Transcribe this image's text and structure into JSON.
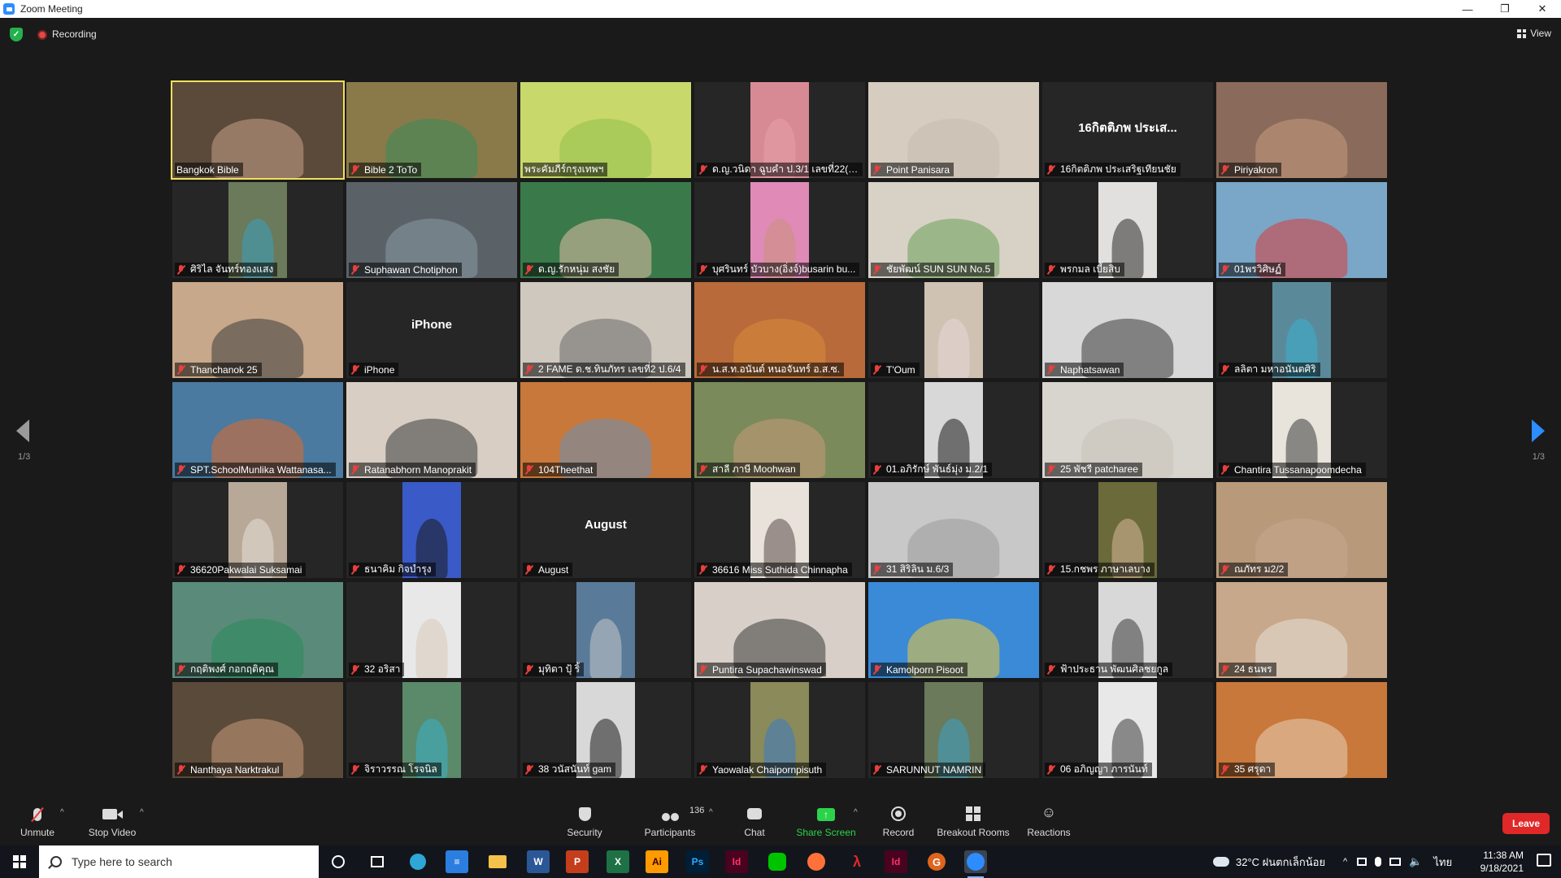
{
  "window": {
    "title": "Zoom Meeting"
  },
  "status": {
    "recording_label": "Recording",
    "view_label": "View"
  },
  "pagination": {
    "left_page": "1/3",
    "right_page": "1/3"
  },
  "tiles": [
    {
      "name": "Bangkok Bible",
      "active": true,
      "muted": false,
      "bg": "#5b4a3a",
      "person": "#c9a38a"
    },
    {
      "name": "Bible 2 ToTo",
      "muted": true,
      "bg": "#8a7a4a",
      "person": "#3a8a5a"
    },
    {
      "name": "พระคัมภีร์กรุงเทพฯ",
      "muted": false,
      "bg": "#c9d86a",
      "person": "#8fc14a"
    },
    {
      "name": "ด.ญ.วนิดา ฉูบคำ ป.3/1 เลขที่22(w...",
      "muted": true,
      "bg": "#d88a94",
      "person": "#e8a0a8",
      "narrow": true
    },
    {
      "name": "Point Panisara",
      "muted": true,
      "bg": "#d6ccc0",
      "person": "#c8bcae"
    },
    {
      "name": "16กิตติภพ ประเสริฐเทียนชัย",
      "muted": true,
      "big": "16กิตติภพ ประเส..."
    },
    {
      "name": "Piriyakron",
      "muted": true,
      "bg": "#8a6a5a",
      "person": "#c89a80"
    },
    {
      "name": "ศิริไล จันทร์ทองแสง",
      "muted": true,
      "bg": "#6a7a5a",
      "person": "#3aa0c0",
      "narrow": true
    },
    {
      "name": "Suphawan Chotiphon",
      "muted": true,
      "bg": "#5a6268",
      "person": "#8a9aa2"
    },
    {
      "name": "ด.ญ.รักหนุ่ม สงชัย",
      "muted": true,
      "bg": "#3a7a4a",
      "person": "#e2c0a8"
    },
    {
      "name": "บุศรินทร์ บัวบาง(อิ่งจ์)busarin bu...",
      "muted": true,
      "bg": "#e08ab8",
      "person": "#c9927a",
      "narrow": true
    },
    {
      "name": "ชัยพัฒน์ SUN SUN No.5",
      "muted": true,
      "bg": "#d8d2c6",
      "person": "#6aa05a"
    },
    {
      "name": "พรกมล เบี้ยสิบ",
      "muted": true,
      "bg": "#e2e0de",
      "person": "#2a2a2a",
      "narrow": true
    },
    {
      "name": "01พรวิศิษฏ์",
      "muted": true,
      "bg": "#7aa6c8",
      "person": "#d83a3a"
    },
    {
      "name": "Thanchanok 25",
      "muted": true,
      "bg": "#c8a88a",
      "person": "#3a3a3a"
    },
    {
      "name": "iPhone",
      "muted": true,
      "big": "iPhone"
    },
    {
      "name": "2 FAME ด.ช.ทินภัทร เลขที่2 ป.6/4",
      "muted": true,
      "bg": "#cfc8be",
      "person": "#6a6a6a"
    },
    {
      "name": "น.ส.ท.อนันต์ หนอจันทร์ อ.ส.ซ.",
      "muted": true,
      "bg": "#b86a3a",
      "person": "#d88a3a"
    },
    {
      "name": "T'Oum",
      "muted": true,
      "bg": "#cfc2b2",
      "person": "#e8d8d8",
      "narrow": true
    },
    {
      "name": "Naphatsawan",
      "muted": true,
      "bg": "#d8d8d8",
      "person": "#3a3a3a"
    },
    {
      "name": "ลลิตา มหาอนันตศิริ",
      "muted": true,
      "bg": "#5a8a9a",
      "person": "#3ab0d0",
      "narrow": true
    },
    {
      "name": "SPT.SchoolMunlika Wattanasa...",
      "muted": true,
      "bg": "#4a7aa0",
      "person": "#e06a2a"
    },
    {
      "name": "Ratanabhorn Manoprakit",
      "muted": true,
      "bg": "#d8cec4",
      "person": "#3a3a3a"
    },
    {
      "name": "104Theethat",
      "muted": true,
      "bg": "#c8783a",
      "person": "#6a90b8"
    },
    {
      "name": "สาลี ภาษี Moohwan",
      "muted": true,
      "bg": "#7a8a5a",
      "person": "#c89a7a"
    },
    {
      "name": "01.อภิรักษ์ พันธ์มุ่ง ม.2/1",
      "muted": true,
      "bg": "#d8d8d8",
      "person": "#1a1a1a",
      "narrow": true
    },
    {
      "name": "25 พัชรี patcharee",
      "muted": true,
      "bg": "#d8d4ce",
      "person": "#c8c2ba"
    },
    {
      "name": "Chantira Tussanapoomdecha",
      "muted": true,
      "bg": "#e8e4dc",
      "person": "#3a3a3a",
      "narrow": true
    },
    {
      "name": "36620Pakwalai Suksamai",
      "muted": true,
      "bg": "#b8a898",
      "person": "#e8e0d8",
      "narrow": true
    },
    {
      "name": "ธนาคิม กิจบำรุง",
      "muted": true,
      "bg": "#3a5ac8",
      "person": "#1a1a1a",
      "narrow": true
    },
    {
      "name": "August",
      "muted": true,
      "big": "August"
    },
    {
      "name": "36616 Miss Suthida Chinnapha",
      "muted": true,
      "bg": "#e8e2da",
      "person": "#5a4a4a",
      "narrow": true
    },
    {
      "name": "31 สิริลิน ม.6/3",
      "muted": true,
      "bg": "#c8c8c8",
      "person": "#9a9a9a"
    },
    {
      "name": "15.กชพร ภาษาเลบาง",
      "muted": true,
      "bg": "#6a6a3a",
      "person": "#d8b89a",
      "narrow": true
    },
    {
      "name": "ณภัทร ม2/2",
      "muted": true,
      "bg": "#b89a7a",
      "person": "#c8a890"
    },
    {
      "name": "กฤติพงศ์ กอกฤติคุณ",
      "muted": true,
      "bg": "#5a8a7a",
      "person": "#2a8a5a"
    },
    {
      "name": "32 อริสา",
      "muted": true,
      "bg": "#e8e8e8",
      "person": "#d8c8b8",
      "narrow": true
    },
    {
      "name": "มุทิตา ปุ้ ริ้",
      "muted": true,
      "bg": "#5a7a9a",
      "person": "#c8c8c8",
      "narrow": true
    },
    {
      "name": "Puntira Supachawinswad",
      "muted": true,
      "bg": "#d8d0c8",
      "person": "#3a3a3a"
    },
    {
      "name": "Kamolporn Pisoot",
      "muted": true,
      "bg": "#3a8ad8",
      "person": "#f0c83a"
    },
    {
      "name": "ฟ้าประธาน พัฒนศิลชยกูล",
      "muted": true,
      "bg": "#d8d8d8",
      "person": "#3a3a3a",
      "narrow": true
    },
    {
      "name": "24 ธนพร",
      "muted": true,
      "bg": "#c8a88a",
      "person": "#e8e0d8"
    },
    {
      "name": "Nanthaya Narktrakul",
      "muted": true,
      "bg": "#5a4a3a",
      "person": "#c89a7a"
    },
    {
      "name": "จิราวรรณ โรจนิล",
      "muted": true,
      "bg": "#5a8a6a",
      "person": "#3ab0c8",
      "narrow": true
    },
    {
      "name": "38 วนัสนันท์ gam",
      "muted": true,
      "bg": "#d8d8d8",
      "person": "#1a1a1a",
      "narrow": true
    },
    {
      "name": "Yaowalak Chaipornpisuth",
      "muted": true,
      "bg": "#8a8a5a",
      "person": "#3a7ac8",
      "narrow": true
    },
    {
      "name": "SARUNNUT NAMRIN",
      "muted": true,
      "bg": "#6a7a5a",
      "person": "#3aa0c8",
      "narrow": true
    },
    {
      "name": "06 อภิญญา ภารนันท์",
      "muted": true,
      "bg": "#e8e8e8",
      "person": "#3a3a3a",
      "narrow": true
    },
    {
      "name": "35 ศรุดา",
      "muted": true,
      "bg": "#c8783a",
      "person": "#e8d0b8"
    }
  ],
  "toolbar": {
    "unmute": "Unmute",
    "stop_video": "Stop Video",
    "security": "Security",
    "participants": "Participants",
    "participants_count": "136",
    "chat": "Chat",
    "share_screen": "Share Screen",
    "record": "Record",
    "breakout_rooms": "Breakout Rooms",
    "reactions": "Reactions",
    "leave": "Leave"
  },
  "taskbar": {
    "search_placeholder": "Type here to search",
    "weather": "32°C  ฝนตกเล็กน้อย",
    "lang": "ไทย",
    "time": "11:38 AM",
    "date": "9/18/2021"
  },
  "colors": {
    "accent_blue": "#2d8cff",
    "share_green": "#2bd34b",
    "leave_red": "#e02828",
    "active_speaker": "#f1e05a",
    "mic_muted": "#e8403c"
  }
}
